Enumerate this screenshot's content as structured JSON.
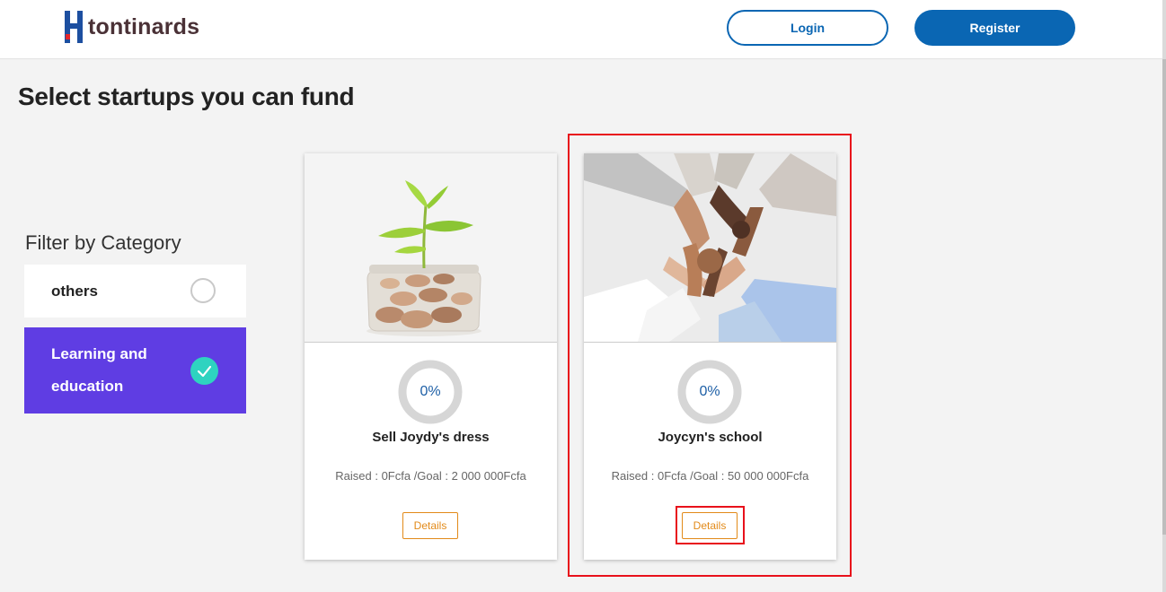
{
  "brand": {
    "name": "tontinards",
    "accent": "#0a66b3",
    "text_color": "#4a3136"
  },
  "header": {
    "login_label": "Login",
    "register_label": "Register"
  },
  "page": {
    "title": "Select startups you can fund"
  },
  "filter": {
    "title": "Filter by Category",
    "items": [
      {
        "label": "others",
        "selected": false
      },
      {
        "label": "Learning and education",
        "selected": true
      }
    ],
    "selected_color": "#5f3de3",
    "check_color": "#2ed3c0"
  },
  "cards": [
    {
      "title": "Sell Joydy's dress",
      "progress": "0%",
      "progress_value": 0,
      "funding": "Raised : 0Fcfa /Goal : 2 000 000Fcfa",
      "details_label": "Details",
      "image": "plant-growing-from-coin-jar"
    },
    {
      "title": "Joycyn's school",
      "progress": "0%",
      "progress_value": 0,
      "funding": "Raised : 0Fcfa /Goal : 50 000 000Fcfa",
      "details_label": "Details",
      "image": "linked-hands-teamwork"
    }
  ],
  "colors": {
    "details": "#e28a19",
    "highlight": "#e8111b",
    "ring": "#d6d6d6",
    "progress_text": "#1d5fa6"
  }
}
